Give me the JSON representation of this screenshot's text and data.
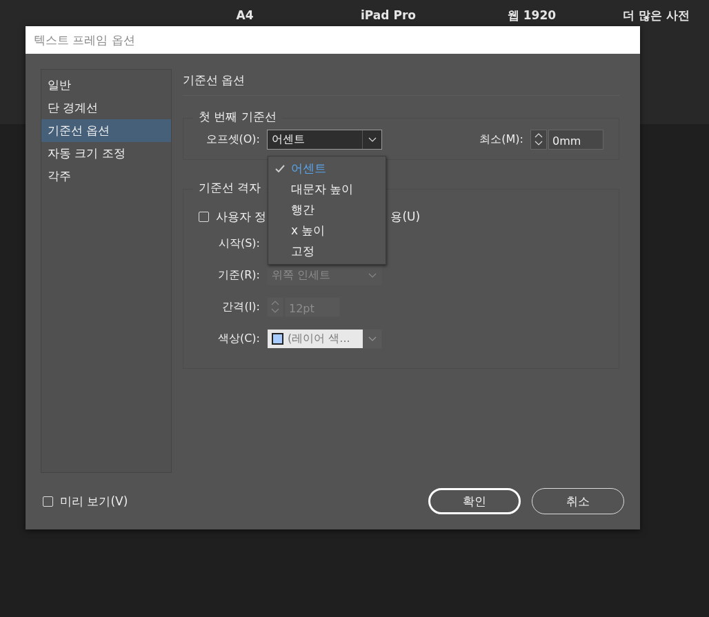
{
  "background_tabs": [
    {
      "label": "A4"
    },
    {
      "label": "iPad Pro"
    },
    {
      "label": "웹 1920"
    },
    {
      "label": "더 많은 사전"
    }
  ],
  "dialog": {
    "title": "텍스트 프레임 옵션"
  },
  "sidebar": {
    "items": [
      {
        "label": "일반",
        "selected": false
      },
      {
        "label": "단 경계선",
        "selected": false
      },
      {
        "label": "기준선 옵션",
        "selected": true
      },
      {
        "label": "자동 크기 조정",
        "selected": false
      },
      {
        "label": "각주",
        "selected": false
      }
    ]
  },
  "panel": {
    "heading": "기준선 옵션",
    "first_baseline": {
      "legend": "첫 번째 기준선",
      "offset": {
        "label": "오프셋(O):",
        "value": "어센트",
        "expanded": true,
        "options": [
          {
            "label": "어센트",
            "selected": true
          },
          {
            "label": "대문자 높이",
            "selected": false
          },
          {
            "label": "행간",
            "selected": false
          },
          {
            "label": "x 높이",
            "selected": false
          },
          {
            "label": "고정",
            "selected": false
          }
        ]
      },
      "minimum": {
        "label": "최소(M):",
        "value": "0mm"
      }
    },
    "baseline_grid": {
      "legend": "기준선 격자",
      "custom": {
        "label_parts": [
          "사용자 정",
          "용(U)"
        ],
        "checked": false
      },
      "rows": [
        {
          "kind": "covered",
          "label": "시작(S):"
        },
        {
          "kind": "dropdown",
          "label": "기준(R):",
          "value": "위쪽 인세트",
          "disabled": true
        },
        {
          "kind": "spinner",
          "label": "간격(I):",
          "value": "12pt",
          "disabled": true
        },
        {
          "kind": "color",
          "label": "색상(C):",
          "value": "(레이어 색...",
          "disabled": false
        }
      ]
    }
  },
  "preview": {
    "label": "미리 보기(V)",
    "checked": false
  },
  "buttons": [
    {
      "label": "확인",
      "default": true
    },
    {
      "label": "취소",
      "default": false
    }
  ]
}
